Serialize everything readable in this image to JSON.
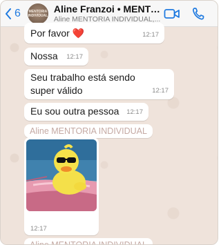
{
  "header": {
    "back_count": "6",
    "contact_name": "Aline Franzoi • MENTORIA INDIVIDUAL",
    "contact_subtitle": "Aline MENTORIA INDIVIDUAL,...",
    "avatar_text": "MENTORIA INDIVIDUAL"
  },
  "messages": [
    {
      "text": "Por favor ❤️",
      "time": "12:17"
    },
    {
      "text": "Nossa",
      "time": "12:17"
    },
    {
      "text": "Seu trabalho está sendo super válido",
      "time": "12:17"
    },
    {
      "text": "Eu sou outra pessoa",
      "time": "12:17"
    }
  ],
  "sender_label": "Aline MENTORIA INDIVIDUAL",
  "photo_message": {
    "time": "12:17",
    "image": "yellow-duck-with-sunglasses-in-pink-car"
  },
  "sender_label_2": "Aline MENTORIA INDIVIDUAL",
  "colors": {
    "accent": "#1f7ae0",
    "sender_name": "#c4a9a3",
    "chat_bg": "#efe3db"
  }
}
